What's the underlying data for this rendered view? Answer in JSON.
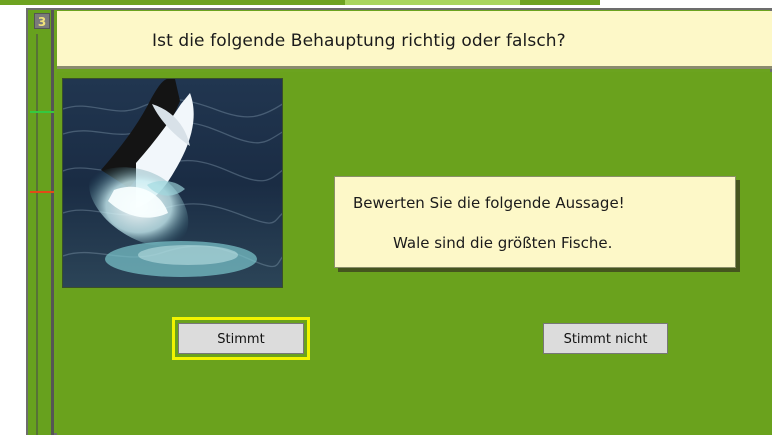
{
  "rail": {
    "question_number": "3"
  },
  "question": {
    "title": "Ist die folgende Behauptung richtig oder falsch?",
    "statement_prompt": "Bewerten Sie die folgende Aussage!",
    "statement": "Wale sind die größten Fische."
  },
  "answers": {
    "true_label": "Stimmt",
    "false_label": "Stimmt nicht"
  },
  "media": {
    "image_subject": "whale-tail"
  },
  "colors": {
    "background": "#6aa21d",
    "panel": "#fdf8c8",
    "selection": "#f1f400"
  }
}
